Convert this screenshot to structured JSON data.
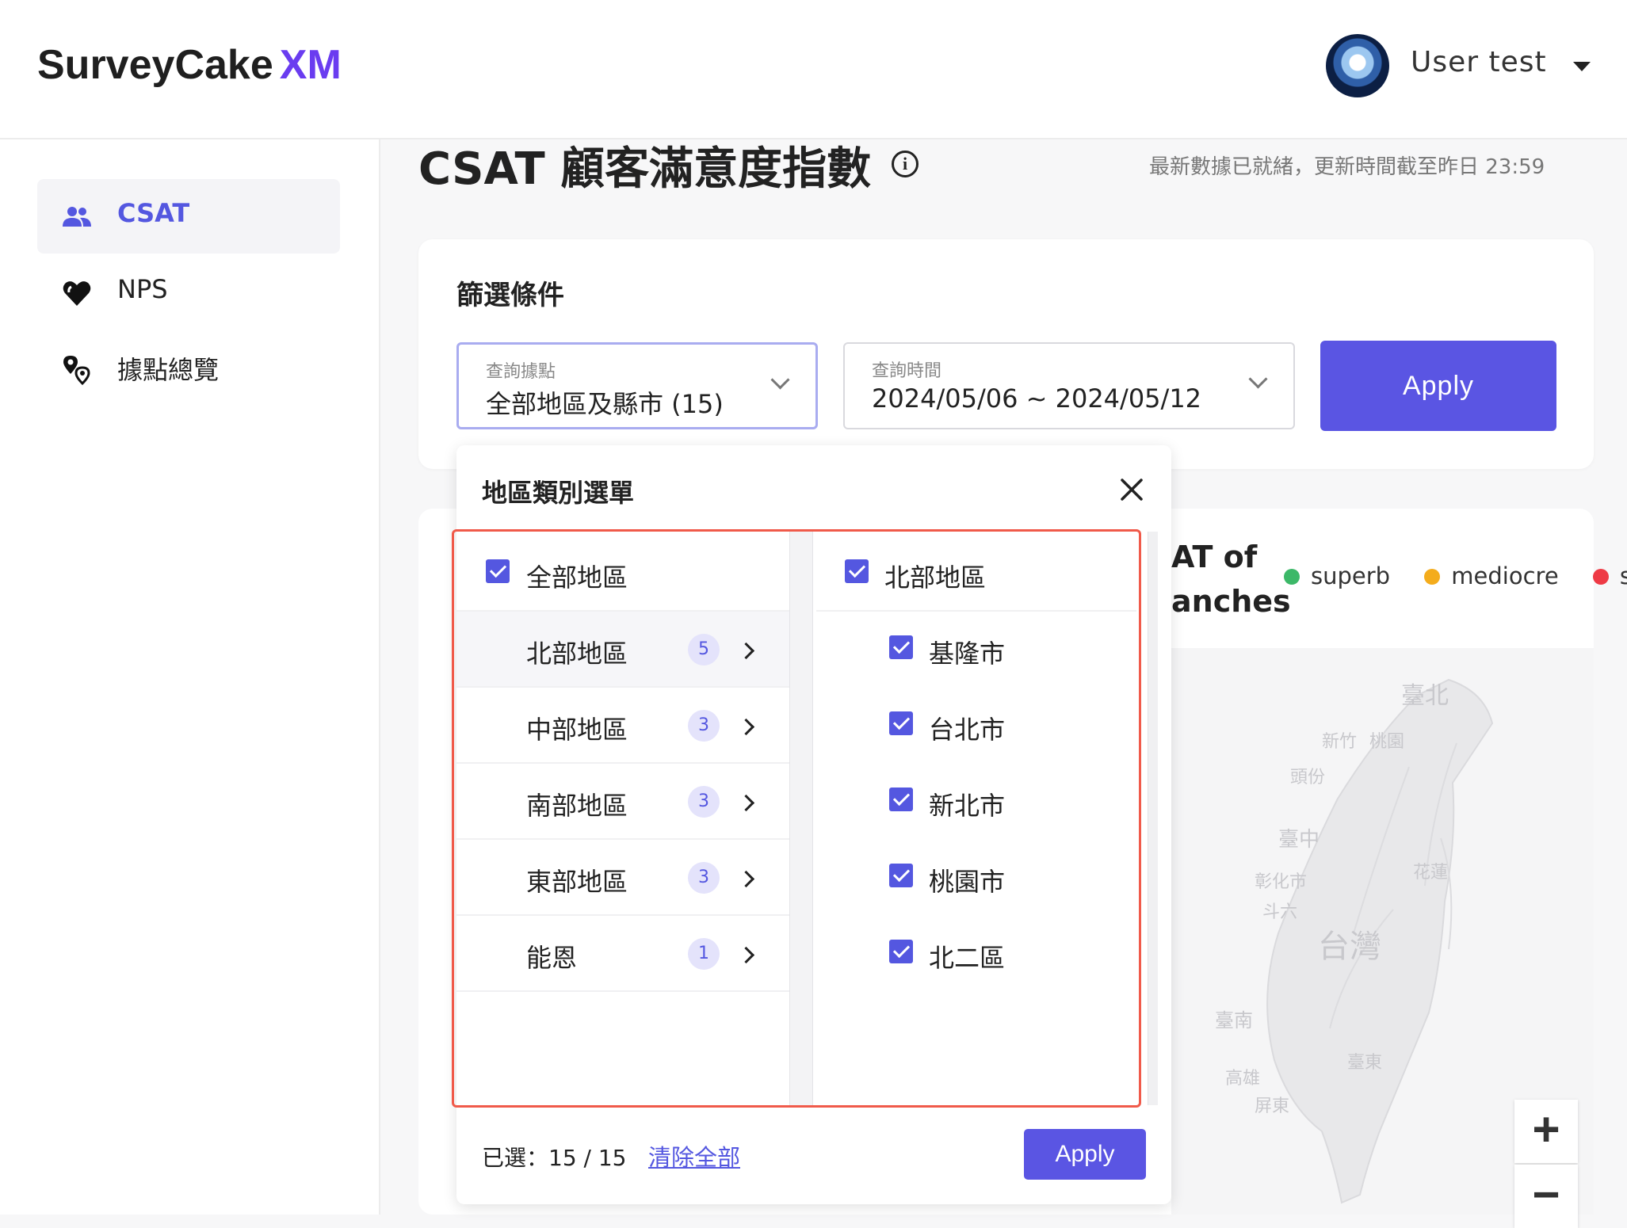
{
  "brand": {
    "name": "SurveyCake",
    "suffix": "XM",
    "suffix_color": "#6a3cf0"
  },
  "user": {
    "name": "User test"
  },
  "sidebar": {
    "items": [
      {
        "label": "CSAT",
        "icon": "users-icon",
        "active": true
      },
      {
        "label": "NPS",
        "icon": "heart-icon",
        "active": false
      },
      {
        "label": "據點總覽",
        "icon": "location-pins-icon",
        "active": false
      }
    ]
  },
  "page": {
    "title": "CSAT 顧客滿意度指數",
    "update_note": "最新數據已就緒，更新時間截至昨日 23:59"
  },
  "filter": {
    "title": "篩選條件",
    "location": {
      "caption": "查詢據點",
      "value": "全部地區及縣市 (15)"
    },
    "time": {
      "caption": "查詢時間",
      "value": "2024/05/06 ~ 2024/05/12"
    },
    "apply_label": "Apply"
  },
  "map_card": {
    "title_line1": "AT of",
    "title_line2": "anches",
    "legend": [
      {
        "label": "superb",
        "color": "#3cb868"
      },
      {
        "label": "mediocre",
        "color": "#f4ac1c"
      },
      {
        "label": "su",
        "color": "#ee3a45"
      }
    ],
    "map_labels": {
      "taipei": "臺北",
      "hsinchu": "新竹",
      "taoyuan": "桃園",
      "toufen": "頭份",
      "taichung": "臺中",
      "hualien": "花蓮",
      "changhua": "彰化市",
      "douliu": "斗六",
      "taiwan": "台灣",
      "tainan": "臺南",
      "taitung": "臺東",
      "kaohsiung": "高雄",
      "pingtung": "屏東"
    },
    "zoom_in": "+",
    "zoom_out": "−"
  },
  "region_panel": {
    "title": "地區類別選單",
    "all_label": "全部地區",
    "regions": [
      {
        "label": "北部地區",
        "count": "5"
      },
      {
        "label": "中部地區",
        "count": "3"
      },
      {
        "label": "南部地區",
        "count": "3"
      },
      {
        "label": "東部地區",
        "count": "3"
      },
      {
        "label": "能恩",
        "count": "1"
      }
    ],
    "right_header": "北部地區",
    "cities": [
      "基隆市",
      "台北市",
      "新北市",
      "桃園市",
      "北二區"
    ],
    "selected_text": "已選：15 / 15",
    "clear_label": "清除全部",
    "apply_label": "Apply"
  }
}
